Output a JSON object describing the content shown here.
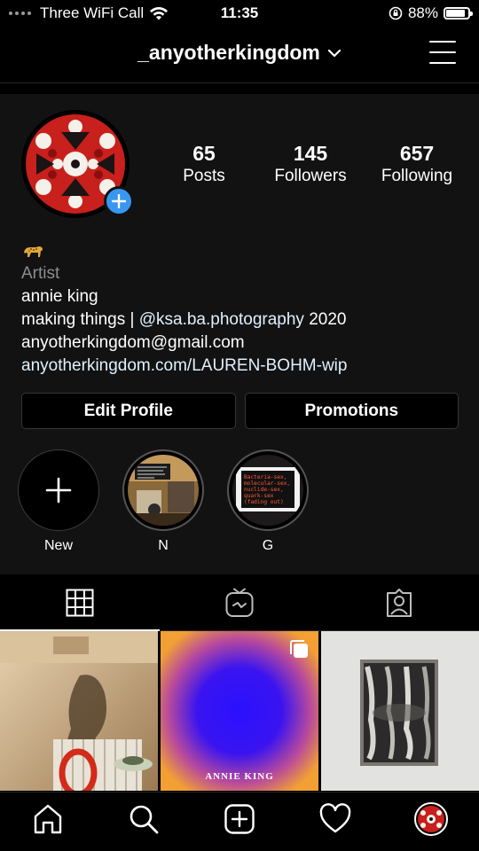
{
  "status_bar": {
    "carrier": "Three WiFi Call",
    "time": "11:35",
    "battery": "88%",
    "battery_level": 0.88
  },
  "header": {
    "username": "_anyotherkingdom",
    "dropdown_icon": "chevron-down-icon",
    "menu_icon": "hamburger-menu-icon"
  },
  "profile": {
    "stats": [
      {
        "value": "65",
        "label": "Posts"
      },
      {
        "value": "145",
        "label": "Followers"
      },
      {
        "value": "657",
        "label": "Following"
      }
    ],
    "bio": {
      "emoji": "🐆",
      "category": "Artist",
      "name": "annie king",
      "line_prefix": "making things | ",
      "mention": "@ksa.ba.photography",
      "line_suffix": " 2020",
      "email": "anyotherkingdom@gmail.com",
      "website": "anyotherkingdom.com/LAUREN-BOHM-wip"
    },
    "buttons": {
      "edit": "Edit Profile",
      "promotions": "Promotions"
    }
  },
  "highlights": [
    {
      "label": "New"
    },
    {
      "label": "N"
    },
    {
      "label": "G",
      "card_text": "Bacteria-sex, molecular-sex, nuclide-sex, quark-sex (fading out)"
    }
  ],
  "grid": [
    {
      "caption": ""
    },
    {
      "caption": "ANNIE KING"
    },
    {
      "caption": ""
    }
  ],
  "colors": {
    "accent": "#3897f0",
    "background": "#000000",
    "surface": "#121212",
    "link": "#e0f1ff"
  }
}
